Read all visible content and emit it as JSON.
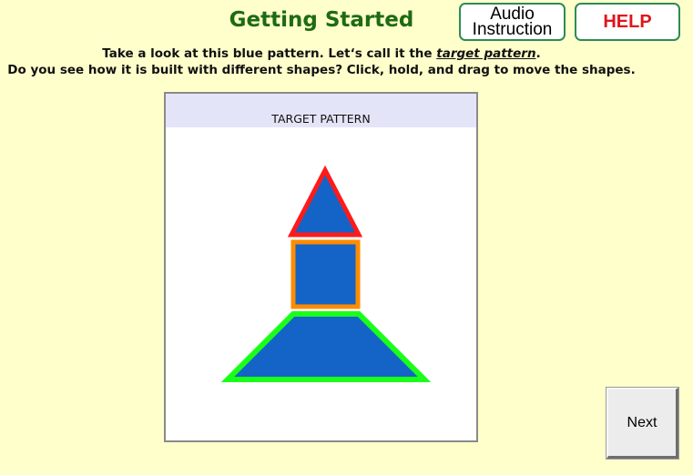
{
  "header": {
    "title": "Getting Started",
    "audio_label_line1": "Audio",
    "audio_label_line2": "Instruction",
    "help_label": "HELP"
  },
  "instructions": {
    "line1_before": "Take a look at this blue pattern. Let‘s call it the ",
    "line1_emphasis": "target pattern",
    "line1_after": ".",
    "line2": "Do you see how it is built with different shapes? Click, hold, and drag to move the shapes."
  },
  "panel": {
    "title": "TARGET PATTERN"
  },
  "shapes": [
    {
      "name": "triangle",
      "fill": "#1464c8",
      "outline": "#ff1a1a"
    },
    {
      "name": "square",
      "fill": "#1464c8",
      "outline": "#ff8c00"
    },
    {
      "name": "trapezoid",
      "fill": "#1464c8",
      "outline": "#1aff1a"
    }
  ],
  "footer": {
    "next_label": "Next"
  },
  "colors": {
    "background": "#ffffcc",
    "title": "#1e6b12",
    "help": "#e0151b",
    "button_border": "#2e8b57",
    "panel_header": "#e4e4f8"
  }
}
